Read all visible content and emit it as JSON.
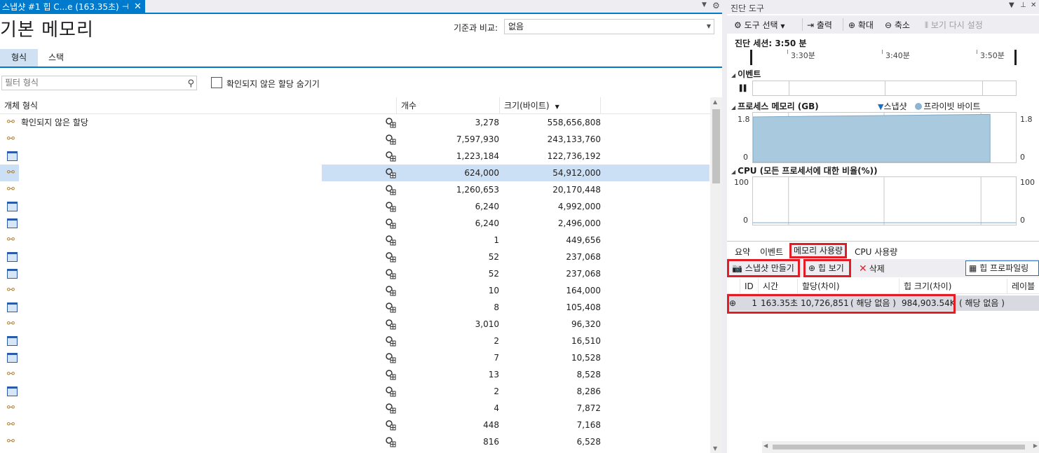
{
  "left": {
    "doc_tab": {
      "title": "스냅샷 #1 힙 C...e (163.35초)",
      "pin": "⊣",
      "close": "✕"
    },
    "page_title": "기본 메모리",
    "compare": {
      "label": "기준과 비교:",
      "value": "없음"
    },
    "tabs": [
      {
        "label": "형식"
      },
      {
        "label": "스택"
      }
    ],
    "filter": {
      "placeholder": "필터 형식"
    },
    "hide_unconfirmed_label": "확인되지 않은 할당 숨기기",
    "columns": {
      "type": "개체 형식",
      "count": "개수",
      "size": "크기(바이트)"
    },
    "rows": [
      {
        "icon": "generic",
        "name": "확인되지 않은 할당",
        "count": "3,278",
        "size": "558,656,808"
      },
      {
        "icon": "generic",
        "name": "",
        "count": "7,597,930",
        "size": "243,133,760"
      },
      {
        "icon": "class",
        "name": "",
        "count": "1,223,184",
        "size": "122,736,192"
      },
      {
        "icon": "generic",
        "name": "",
        "count": "624,000",
        "size": "54,912,000"
      },
      {
        "icon": "generic",
        "name": "",
        "count": "1,260,653",
        "size": "20,170,448"
      },
      {
        "icon": "class",
        "name": "",
        "count": "6,240",
        "size": "4,992,000"
      },
      {
        "icon": "class",
        "name": "",
        "count": "6,240",
        "size": "2,496,000"
      },
      {
        "icon": "generic",
        "name": "",
        "count": "1",
        "size": "449,656"
      },
      {
        "icon": "class",
        "name": "",
        "count": "52",
        "size": "237,068"
      },
      {
        "icon": "class",
        "name": "",
        "count": "52",
        "size": "237,068"
      },
      {
        "icon": "generic",
        "name": "",
        "count": "10",
        "size": "164,000"
      },
      {
        "icon": "class",
        "name": "",
        "count": "8",
        "size": "105,408"
      },
      {
        "icon": "generic",
        "name": "",
        "count": "3,010",
        "size": "96,320"
      },
      {
        "icon": "class",
        "name": "",
        "count": "2",
        "size": "16,510"
      },
      {
        "icon": "class",
        "name": "",
        "count": "7",
        "size": "10,528"
      },
      {
        "icon": "generic",
        "name": "",
        "count": "13",
        "size": "8,528"
      },
      {
        "icon": "class",
        "name": "",
        "count": "2",
        "size": "8,286"
      },
      {
        "icon": "generic",
        "name": "",
        "count": "4",
        "size": "7,872"
      },
      {
        "icon": "generic",
        "name": "",
        "count": "448",
        "size": "7,168"
      },
      {
        "icon": "generic",
        "name": "",
        "count": "816",
        "size": "6,528"
      }
    ],
    "selected_row": 3
  },
  "right": {
    "title": "진단 도구",
    "toolbar": {
      "tools": "도구 선택",
      "output": "출력",
      "zoom_in": "확대",
      "zoom_out": "축소",
      "reset_view": "보기 다시 설정"
    },
    "session": "진단 세션: 3:50 분",
    "ruler": [
      "3:30분",
      "3:40분",
      "3:50분"
    ],
    "events_title": "이벤트",
    "memory_title": "프로세스 메모리 (GB)",
    "memory_legend": {
      "snapshot": "스냅샷",
      "private": "프라이빗 바이트"
    },
    "memory_axis": {
      "max": "1.8",
      "min": "0"
    },
    "cpu_title": "CPU (모든 프로세서에 대한 비율(%))",
    "cpu_axis": {
      "max": "100",
      "min": "0"
    },
    "bottom_tabs": {
      "summary": "요약",
      "events": "이벤트",
      "memory": "메모리 사용량",
      "cpu": "CPU 사용량"
    },
    "mem_toolbar": {
      "snapshot": "스냅샷 만들기",
      "heap": "힙 보기",
      "delete": "삭제",
      "heap_profiling": "힙 프로파일링"
    },
    "snap_columns": {
      "id": "ID",
      "time": "시간",
      "alloc": "할당(차이)",
      "heap": "힙 크기(차이)",
      "layer": "레이블"
    },
    "snapshot": {
      "id": "1",
      "time": "163.35초",
      "alloc": "10,726,851",
      "alloc_diff": "( 해당 없음 )",
      "heap": "984,903.54KB",
      "heap_diff": "( 해당 없음 )"
    }
  },
  "chart_data": [
    {
      "type": "area",
      "title": "프로세스 메모리 (GB)",
      "series": [
        {
          "name": "프라이빗 바이트",
          "values": [
            1.65,
            1.66,
            1.67,
            1.68,
            1.69,
            1.7,
            1.71,
            1.72,
            1.73,
            1.74
          ]
        }
      ],
      "ylim": [
        0,
        1.8
      ]
    },
    {
      "type": "line",
      "title": "CPU (모든 프로세서에 대한 비율(%))",
      "series": [
        {
          "values": [
            0,
            0,
            0,
            0,
            0,
            0,
            0,
            0,
            0,
            0
          ]
        }
      ],
      "ylim": [
        0,
        100
      ]
    }
  ]
}
